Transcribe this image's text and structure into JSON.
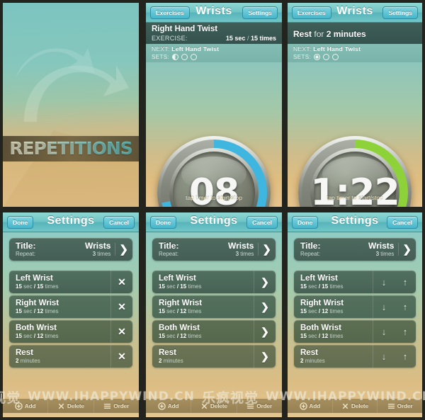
{
  "splash": {
    "title": "REPETITIONS",
    "arrow_icon": "circular-arrow-icon",
    "phone_icon": "iphone-illustration"
  },
  "navbar": {
    "back_label": "Exercises",
    "title": "Wrists",
    "settings_label": "Settings"
  },
  "timer_screens": [
    {
      "exercise_name": "Right Hand Twist",
      "exercise_label": "EXERCISE:",
      "duration": "15 sec",
      "separator": "/",
      "count": "15 times",
      "next_label": "NEXT:",
      "next_value": "Left Hand Twist",
      "sets_label": "SETS:",
      "sets": [
        "half",
        "empty",
        "empty"
      ],
      "time": "08",
      "ring_color": "#3fb6e0",
      "progress": 0.72,
      "hint": "tap timer to start/stop"
    },
    {
      "rest_word": "Rest",
      "rest_for": "for",
      "rest_duration": "2 minutes",
      "next_label": "NEXT:",
      "next_value": "Left Hand Twist",
      "sets_label": "SETS:",
      "sets": [
        "full",
        "empty",
        "empty"
      ],
      "time": "1:22",
      "ring_color": "#8ed23a",
      "progress": 0.7,
      "hint": "tap timer to start/stop"
    }
  ],
  "settings": {
    "done_label": "Done",
    "title": "Settings",
    "cancel_label": "Cancel",
    "title_card": {
      "label": "Title:",
      "value": "Wrists",
      "repeat_label": "Repeat:",
      "repeat_count": "3",
      "repeat_unit": "times",
      "chevron_icon": "chevron-right-icon"
    },
    "rows": [
      {
        "name": "Left Wrist",
        "duration": "15",
        "unit": "sec",
        "sep": "/",
        "count": "15",
        "count_unit": "times"
      },
      {
        "name": "Right Wrist",
        "duration": "15",
        "unit": "sec",
        "sep": "/",
        "count": "12",
        "count_unit": "times"
      },
      {
        "name": "Both Wrist",
        "duration": "15",
        "unit": "sec",
        "sep": "/",
        "count": "12",
        "count_unit": "times"
      },
      {
        "name": "Rest",
        "duration": "2",
        "unit": "minutes",
        "sep": "",
        "count": "",
        "count_unit": ""
      }
    ],
    "modes": {
      "delete": {
        "icon": "close-x-icon",
        "glyph": "✕"
      },
      "disclosure": {
        "icon": "chevron-right-icon",
        "glyph": "❯"
      },
      "reorder": {
        "down_icon": "arrow-down-icon",
        "down_glyph": "↓",
        "up_icon": "arrow-up-icon",
        "up_glyph": "↑"
      }
    },
    "toolbar": [
      {
        "label": "Add",
        "icon": "plus-circle-icon"
      },
      {
        "label": "Delete",
        "icon": "close-x-icon"
      },
      {
        "label": "Order",
        "icon": "reorder-icon"
      }
    ]
  },
  "watermark": {
    "cn_left": "视觉",
    "url1": "WWW.IHAPPYWIND.CN",
    "cn_mid": "乐疯视觉",
    "url2": "WWW.IHAPPYWIND.CN"
  },
  "colors": {
    "accent_blue": "#3fb6e0",
    "accent_green": "#8ed23a",
    "nav_teal": "#6fc4c5",
    "card_green": "#4e6a5f",
    "sand": "#e0bd80"
  }
}
